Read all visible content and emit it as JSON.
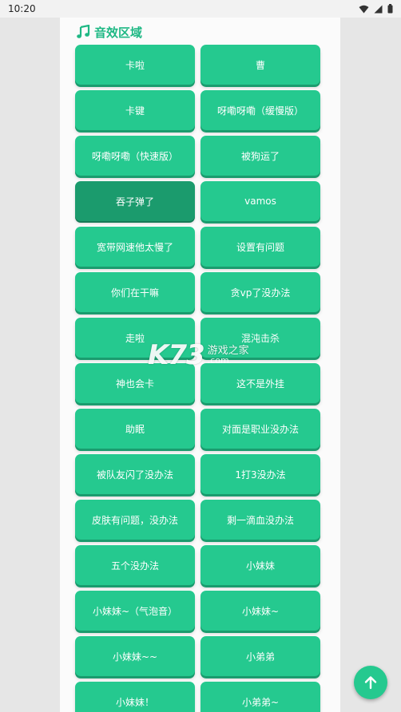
{
  "status_bar": {
    "time": "10:20",
    "icons": [
      "wifi-icon",
      "signal-icon",
      "battery-icon"
    ]
  },
  "section": {
    "title": "音效区域",
    "icon": "music-note-icon"
  },
  "colors": {
    "accent": "#25c98f",
    "accent_pressed": "#1b9b6d",
    "accent_text": "#1eb884"
  },
  "sounds": [
    {
      "label": "卡啦"
    },
    {
      "label": "曹"
    },
    {
      "label": "卡键"
    },
    {
      "label": "呀嘞呀嘞（缓慢版）"
    },
    {
      "label": "呀嘞呀嘞（快速版）"
    },
    {
      "label": "被狗运了"
    },
    {
      "label": "吞子弹了",
      "pressed": true
    },
    {
      "label": "vamos"
    },
    {
      "label": "宽带网速他太慢了"
    },
    {
      "label": "设置有问题"
    },
    {
      "label": "你们在干嘛"
    },
    {
      "label": "贪vp了没办法"
    },
    {
      "label": "走啦"
    },
    {
      "label": "混沌击杀"
    },
    {
      "label": "神也会卡"
    },
    {
      "label": "这不是外挂"
    },
    {
      "label": "助眠"
    },
    {
      "label": "对面是职业没办法"
    },
    {
      "label": "被队友闪了没办法"
    },
    {
      "label": "1打3没办法"
    },
    {
      "label": "皮肤有问题，没办法"
    },
    {
      "label": "剩一滴血没办法"
    },
    {
      "label": "五个没办法"
    },
    {
      "label": "小妹妹"
    },
    {
      "label": "小妹妹~（气泡音）"
    },
    {
      "label": "小妹妹~"
    },
    {
      "label": "小妹妹~~"
    },
    {
      "label": "小弟弟"
    },
    {
      "label": "小妹妹！"
    },
    {
      "label": "小弟弟~"
    }
  ],
  "watermark": {
    "logo": "K73",
    "text": "游戏之家",
    "domain": ".com"
  },
  "fab": {
    "icon": "arrow-up-icon"
  }
}
